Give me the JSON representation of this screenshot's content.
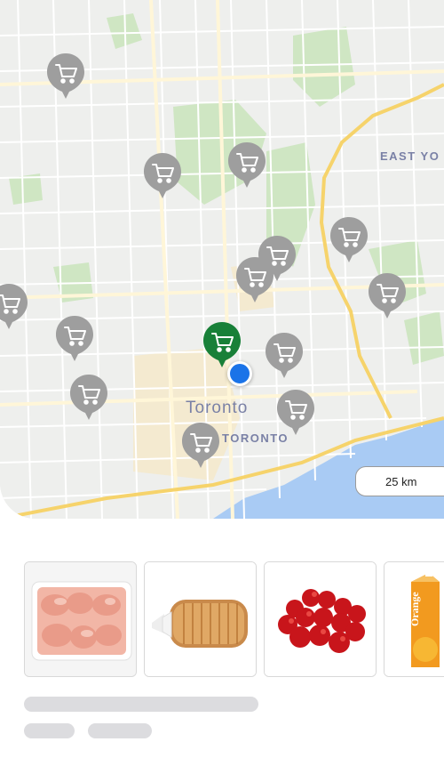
{
  "map": {
    "city_label": "Toronto",
    "district_labels": [
      "EAST YO",
      "TORONTO"
    ],
    "scale_label": "25 km",
    "colors": {
      "land": "#eeefed",
      "park": "#cfe6c3",
      "water": "#a9cbf4",
      "highway": "#f6d36b",
      "store_pin": "#9e9e9e",
      "selected_pin": "#188038",
      "user_location": "#1a73e8"
    },
    "store_pins": [
      {
        "name": "store-pin",
        "icon": "shopping-cart-icon"
      },
      {
        "name": "store-pin",
        "icon": "shopping-cart-icon"
      },
      {
        "name": "store-pin",
        "icon": "shopping-cart-icon"
      },
      {
        "name": "store-pin",
        "icon": "shopping-cart-icon"
      },
      {
        "name": "store-pin",
        "icon": "shopping-cart-icon"
      },
      {
        "name": "store-pin",
        "icon": "shopping-cart-icon"
      },
      {
        "name": "store-pin",
        "icon": "shopping-cart-icon"
      },
      {
        "name": "store-pin",
        "icon": "shopping-cart-icon"
      },
      {
        "name": "store-pin",
        "icon": "shopping-cart-icon"
      },
      {
        "name": "store-pin",
        "icon": "shopping-cart-icon"
      },
      {
        "name": "store-pin",
        "icon": "shopping-cart-icon"
      },
      {
        "name": "store-pin",
        "icon": "shopping-cart-icon"
      },
      {
        "name": "store-pin",
        "icon": "shopping-cart-icon"
      }
    ],
    "selected_pin": {
      "icon": "shopping-cart-icon"
    }
  },
  "products": [
    {
      "name": "raw-chicken-thighs",
      "image": "chicken-tray-image"
    },
    {
      "name": "sliced-bread-loaf",
      "image": "bread-image"
    },
    {
      "name": "red-apples",
      "image": "apples-image"
    },
    {
      "name": "orange-juice-carton",
      "image": "orange-juice-image"
    }
  ],
  "juice_carton_text": "Orange",
  "loading_placeholders": 3
}
